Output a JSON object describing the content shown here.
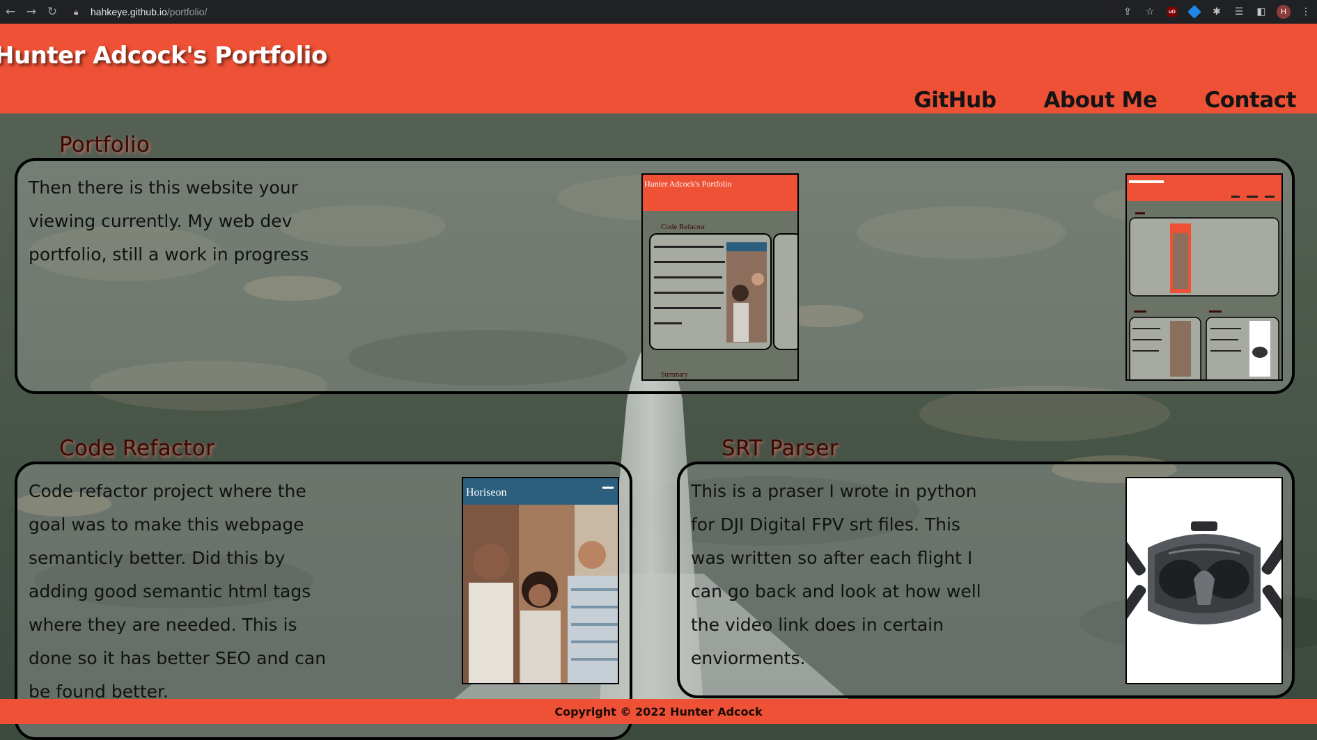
{
  "browser": {
    "url_host": "hahkeye.github.io",
    "url_path": "/portfolio/",
    "avatar_letter": "H",
    "ext_label": "uO"
  },
  "header": {
    "title": "Hunter Adcock's Portfolio",
    "nav": [
      "GitHub",
      "About Me",
      "Contact"
    ],
    "bg_color": "#ee5135"
  },
  "sections": {
    "portfolio": {
      "title": "Portfolio",
      "text": "Then there is this website your viewing currently. My web dev portfolio, still a work in progress",
      "shot_title": "Hunter Adcock's Portfolio",
      "shot_section": "Code Refactor",
      "shot_summary": "Summary"
    },
    "code_refactor": {
      "title": "Code Refactor",
      "text": "Code refactor project where the goal was to make this webpage semanticly better. Did this by adding good semantic html tags where they are needed. This is done so it has better SEO and can be found better.",
      "shot_brand": "Horiseon"
    },
    "srt_parser": {
      "title": "SRT Parser",
      "text": "This is a praser I wrote in python for DJI Digital FPV srt files. This was written so after each flight I can go back and look at how well the video link does in certain enviorments."
    }
  },
  "footer": {
    "text": "Copyright © 2022 Hunter Adcock"
  }
}
